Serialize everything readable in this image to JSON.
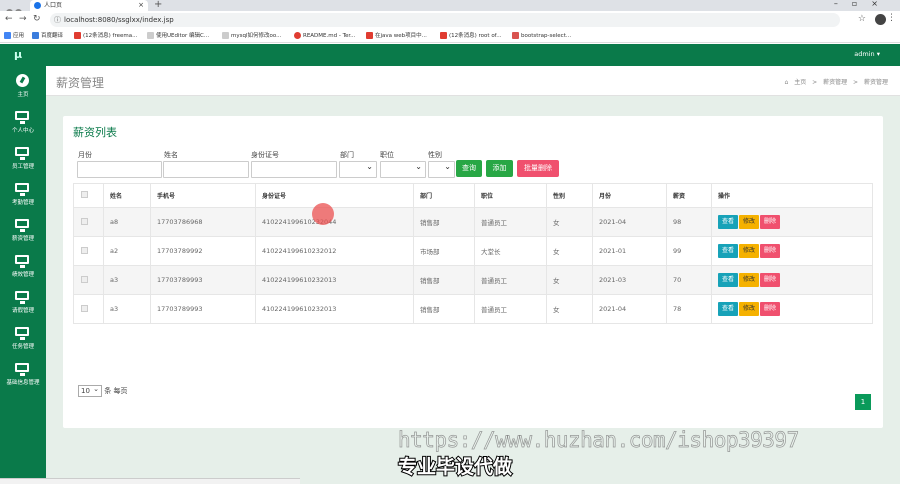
{
  "browser": {
    "tab_title": "人口页",
    "url": "localhost:8080/ssglxx/index.jsp",
    "bookmarks": [
      "应用",
      "百度翻译",
      "(12条消息) freema...",
      "使用UEditor 编辑C...",
      "mysql如何修改oo...",
      "README.md - Ter...",
      "在java web项目中...",
      "(12条消息) root of...",
      "bootstrap-select..."
    ]
  },
  "header": {
    "logo": "μ",
    "user": "admin ▾"
  },
  "sidebar": {
    "items": [
      {
        "label": "主页",
        "icon": "dashboard-icon"
      },
      {
        "label": "个人中心",
        "icon": "monitor-icon"
      },
      {
        "label": "员工管理",
        "icon": "monitor-icon"
      },
      {
        "label": "考勤管理",
        "icon": "monitor-icon"
      },
      {
        "label": "薪资管理",
        "icon": "monitor-icon"
      },
      {
        "label": "绩效管理",
        "icon": "monitor-icon"
      },
      {
        "label": "请假管理",
        "icon": "monitor-icon"
      },
      {
        "label": "任务管理",
        "icon": "monitor-icon"
      },
      {
        "label": "基础信息管理",
        "icon": "monitor-icon"
      }
    ]
  },
  "page": {
    "title": "薪资管理",
    "breadcrumb": {
      "home": "主页",
      "sep": ">",
      "level1": "薪资管理",
      "level2": "薪资管理"
    }
  },
  "card": {
    "title": "薪资列表",
    "filters": {
      "month": "月份",
      "name": "姓名",
      "idcard": "身份证号",
      "dept": "部门",
      "position": "职位",
      "gender": "性别"
    },
    "buttons": {
      "search": "查询",
      "add": "添加",
      "batch_delete": "批量删除"
    },
    "columns": [
      "姓名",
      "手机号",
      "身份证号",
      "部门",
      "职位",
      "性别",
      "月份",
      "薪资",
      "操作"
    ],
    "rows": [
      {
        "name": "a8",
        "phone": "17703786968",
        "idcard": "410224199610232044",
        "dept": "销售部",
        "position": "普通员工",
        "gender": "女",
        "month": "2021-04",
        "salary": "98"
      },
      {
        "name": "a2",
        "phone": "17703789992",
        "idcard": "410224199610232012",
        "dept": "市场部",
        "position": "大堂长",
        "gender": "女",
        "month": "2021-01",
        "salary": "99"
      },
      {
        "name": "a3",
        "phone": "17703789993",
        "idcard": "410224199610232013",
        "dept": "销售部",
        "position": "普通员工",
        "gender": "女",
        "month": "2021-03",
        "salary": "70"
      },
      {
        "name": "a3",
        "phone": "17703789993",
        "idcard": "410224199610232013",
        "dept": "销售部",
        "position": "普通员工",
        "gender": "女",
        "month": "2021-04",
        "salary": "78"
      }
    ],
    "row_actions": {
      "view": "查看",
      "edit": "修改",
      "delete": "删除"
    },
    "pagination": {
      "page_size": "10",
      "per_page_label": "条 每页",
      "current_page": "1"
    }
  },
  "overlay": {
    "watermark": "https://www.huzhan.com/ishop39397",
    "caption": "专业毕设代做"
  }
}
